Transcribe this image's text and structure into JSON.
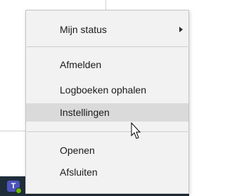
{
  "context_menu": {
    "items": [
      {
        "label": "Mijn status",
        "has_submenu": true
      },
      {
        "label": "Afmelden"
      },
      {
        "label": "Logboeken ophalen"
      },
      {
        "label": "Instellingen",
        "highlighted": true
      },
      {
        "label": "Openen"
      },
      {
        "label": "Afsluiten"
      }
    ]
  },
  "taskbar": {
    "tray_icons": [
      "teams-icon",
      "green-tray-icon",
      "overflow-dots-icon",
      "blue-tray-icon",
      "gold-tray-icon"
    ],
    "teams_glyph": "T"
  },
  "colors": {
    "menu_background": "#f2f2f2",
    "hover_background": "#dadada",
    "taskbar_background": "#1f2d3a",
    "teams_brand": "#4b53bc",
    "status_available": "#6bb700"
  }
}
